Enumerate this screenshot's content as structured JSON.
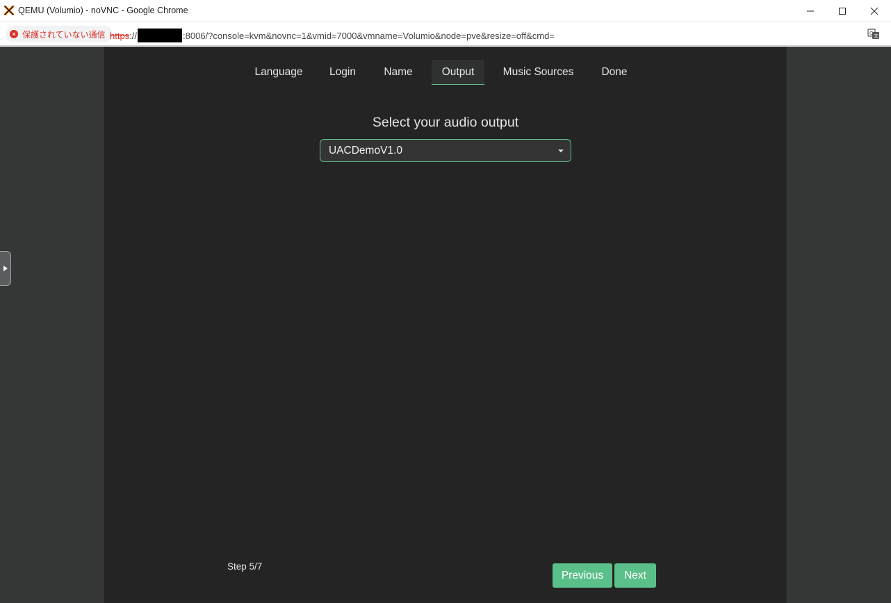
{
  "window": {
    "title": "QEMU (Volumio) - noVNC - Google Chrome",
    "app_icon": "proxmox-x-icon",
    "controls": [
      "minimize-icon",
      "maximize-icon",
      "close-icon"
    ]
  },
  "addressbar": {
    "security_label": "保護されていない通信",
    "url_scheme": "https",
    "url_sep": "://",
    "url_rest": ":8006/?console=kvm&novnc=1&vmid=7000&vmname=Volumio&node=pve&resize=off&cmd=",
    "translate_icon": "translate-icon"
  },
  "wizard": {
    "tabs": [
      {
        "label": "Language",
        "active": false
      },
      {
        "label": "Login",
        "active": false
      },
      {
        "label": "Name",
        "active": false
      },
      {
        "label": "Output",
        "active": true
      },
      {
        "label": "Music Sources",
        "active": false
      },
      {
        "label": "Done",
        "active": false
      }
    ],
    "heading": "Select your audio output",
    "output_select": {
      "value": "UACDemoV1.0"
    },
    "step": "Step 5/7",
    "buttons": {
      "previous": "Previous",
      "next": "Next"
    }
  },
  "colors": {
    "accent": "#5bbf89",
    "panel_bg": "#242424",
    "page_bg": "#353636",
    "insecure": "#d93025"
  }
}
